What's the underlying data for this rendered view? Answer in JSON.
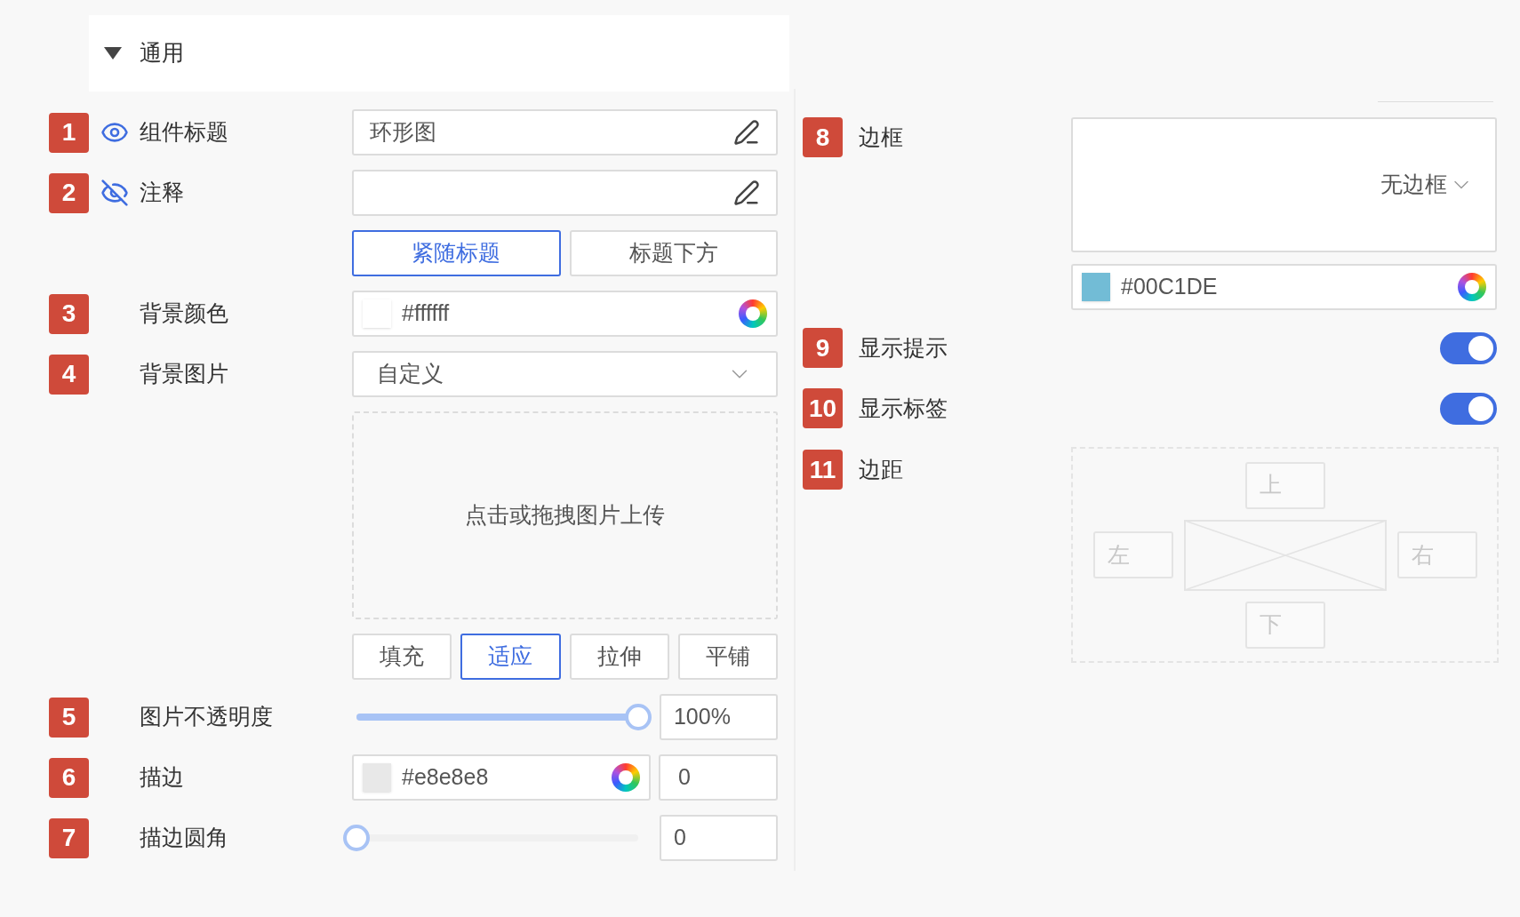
{
  "section": {
    "title": "通用",
    "expanded": true
  },
  "left_rows": [
    {
      "kind": "text",
      "badge": "1",
      "visible": true,
      "label": "组件标题",
      "value": "环形图"
    },
    {
      "kind": "text",
      "badge": "2",
      "visible": false,
      "label": "注释",
      "value": ""
    },
    {
      "kind": "segment",
      "options": [
        {
          "label": "紧随标题",
          "selected": true
        },
        {
          "label": "标题下方",
          "selected": false
        }
      ]
    },
    {
      "kind": "color",
      "badge": "3",
      "label": "背景颜色",
      "value": "#ffffff",
      "color": "#ffffff"
    },
    {
      "kind": "select",
      "badge": "4",
      "label": "背景图片",
      "value": "自定义"
    },
    {
      "kind": "upload",
      "text": "点击或拖拽图片上传"
    },
    {
      "kind": "segment",
      "options": [
        {
          "label": "填充",
          "selected": false
        },
        {
          "label": "适应",
          "selected": true
        },
        {
          "label": "拉伸",
          "selected": false
        },
        {
          "label": "平铺",
          "selected": false
        }
      ]
    },
    {
      "kind": "slider",
      "badge": "5",
      "label": "图片不透明度",
      "level": 1,
      "reading": "100%"
    },
    {
      "kind": "color_number",
      "badge": "6",
      "label": "描边",
      "value": "#e8e8e8",
      "color": "#e8e8e8",
      "number": "0"
    },
    {
      "kind": "slider",
      "badge": "7",
      "label": "描边圆角",
      "level": 0,
      "reading": "0"
    }
  ],
  "border": {
    "badge": "8",
    "label": "边框",
    "select_value": "无边框",
    "color_value": "#00C1DE",
    "color": "#72bcd6"
  },
  "toggles": [
    {
      "badge": "9",
      "label": "显示提示",
      "on": true
    },
    {
      "badge": "10",
      "label": "显示标签",
      "on": true
    }
  ],
  "margin": {
    "badge": "11",
    "label": "边距",
    "top": "上",
    "left": "左",
    "right": "右",
    "bottom": "下"
  }
}
